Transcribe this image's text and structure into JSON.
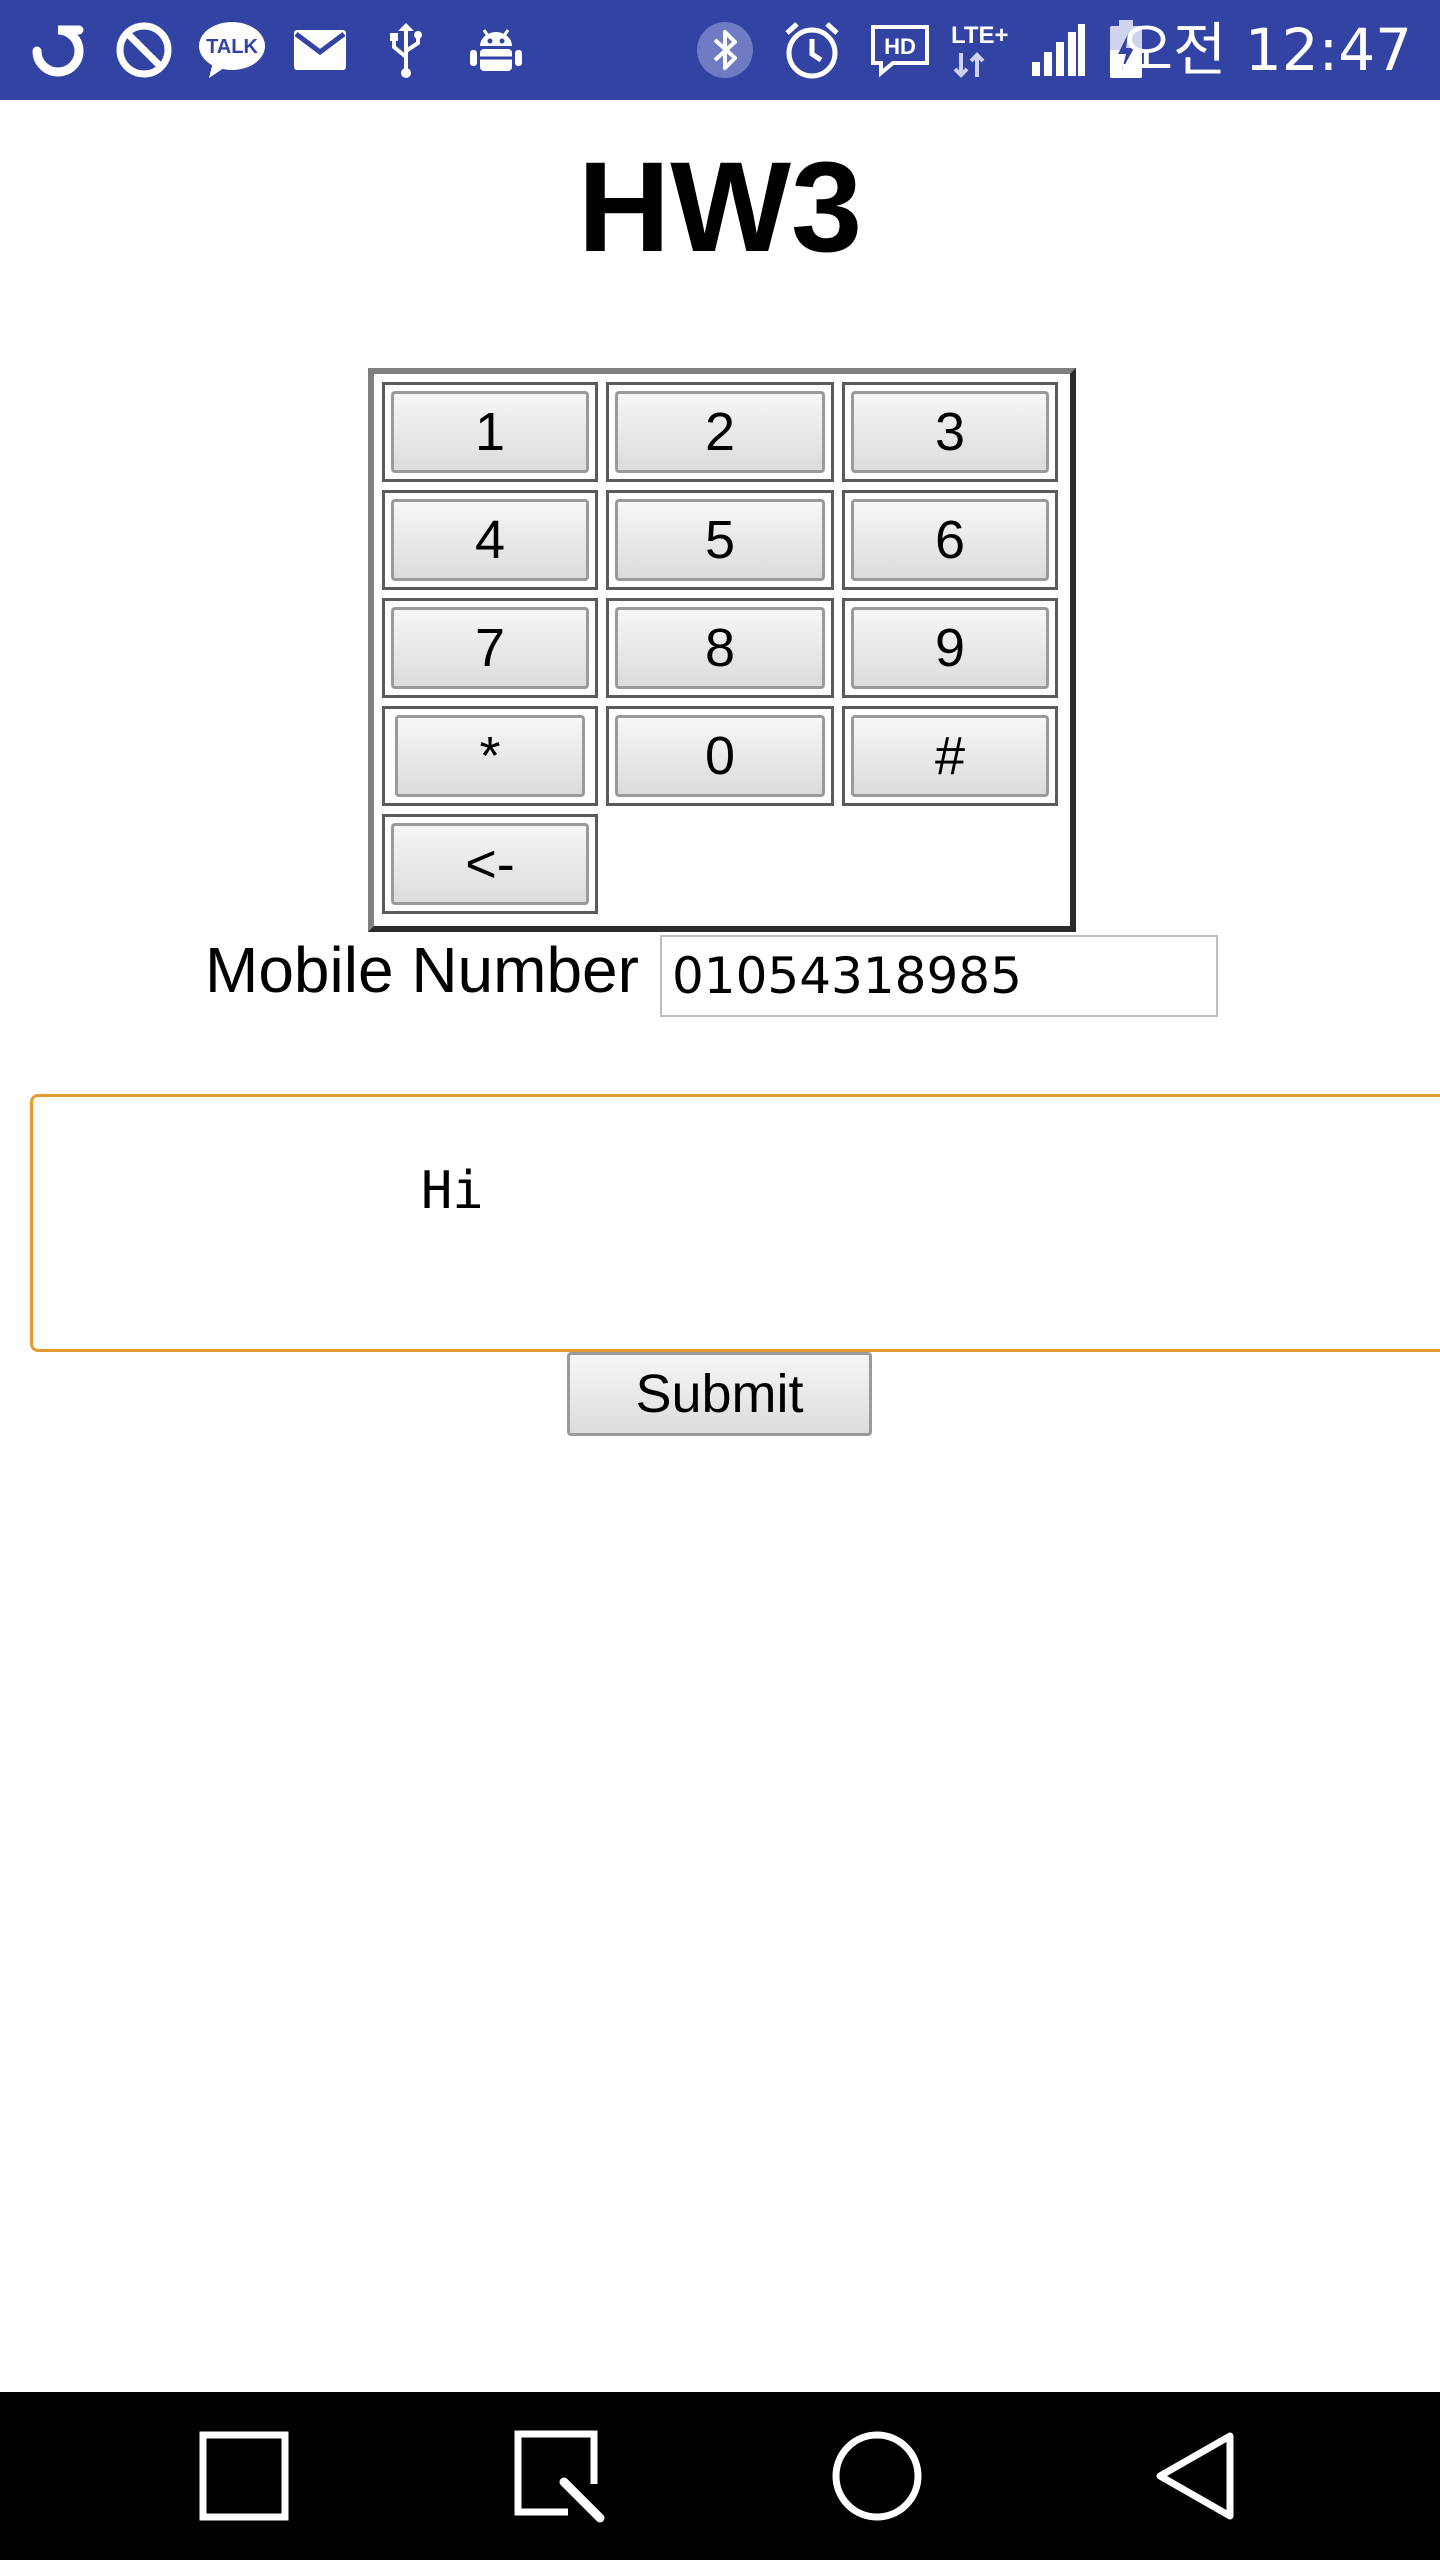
{
  "status_bar": {
    "time": "오전 12:47",
    "icons": [
      "app-notification-icon",
      "blocked-icon",
      "kakaotalk-icon",
      "mail-icon",
      "usb-icon",
      "android-debug-icon",
      "bluetooth-icon",
      "alarm-icon",
      "hd-voice-icon",
      "lte-icon",
      "signal-icon",
      "battery-charging-icon"
    ],
    "background_color": "#3343a3",
    "talk_label": "TALK",
    "hd_label": "HD",
    "lte_label": "LTE+"
  },
  "page": {
    "title": "HW3"
  },
  "keypad": {
    "keys": [
      "1",
      "2",
      "3",
      "4",
      "5",
      "6",
      "7",
      "8",
      "9",
      "*",
      "0",
      "#",
      "<-"
    ]
  },
  "form": {
    "mobile_label": "Mobile Number",
    "mobile_value": "01054318985",
    "message_value": "Hi",
    "submit_label": "Submit",
    "focus_color": "#e59a2f"
  },
  "nav_bar": {
    "icons": [
      "recent-apps-icon",
      "screenshot-icon",
      "home-icon",
      "back-icon"
    ]
  }
}
